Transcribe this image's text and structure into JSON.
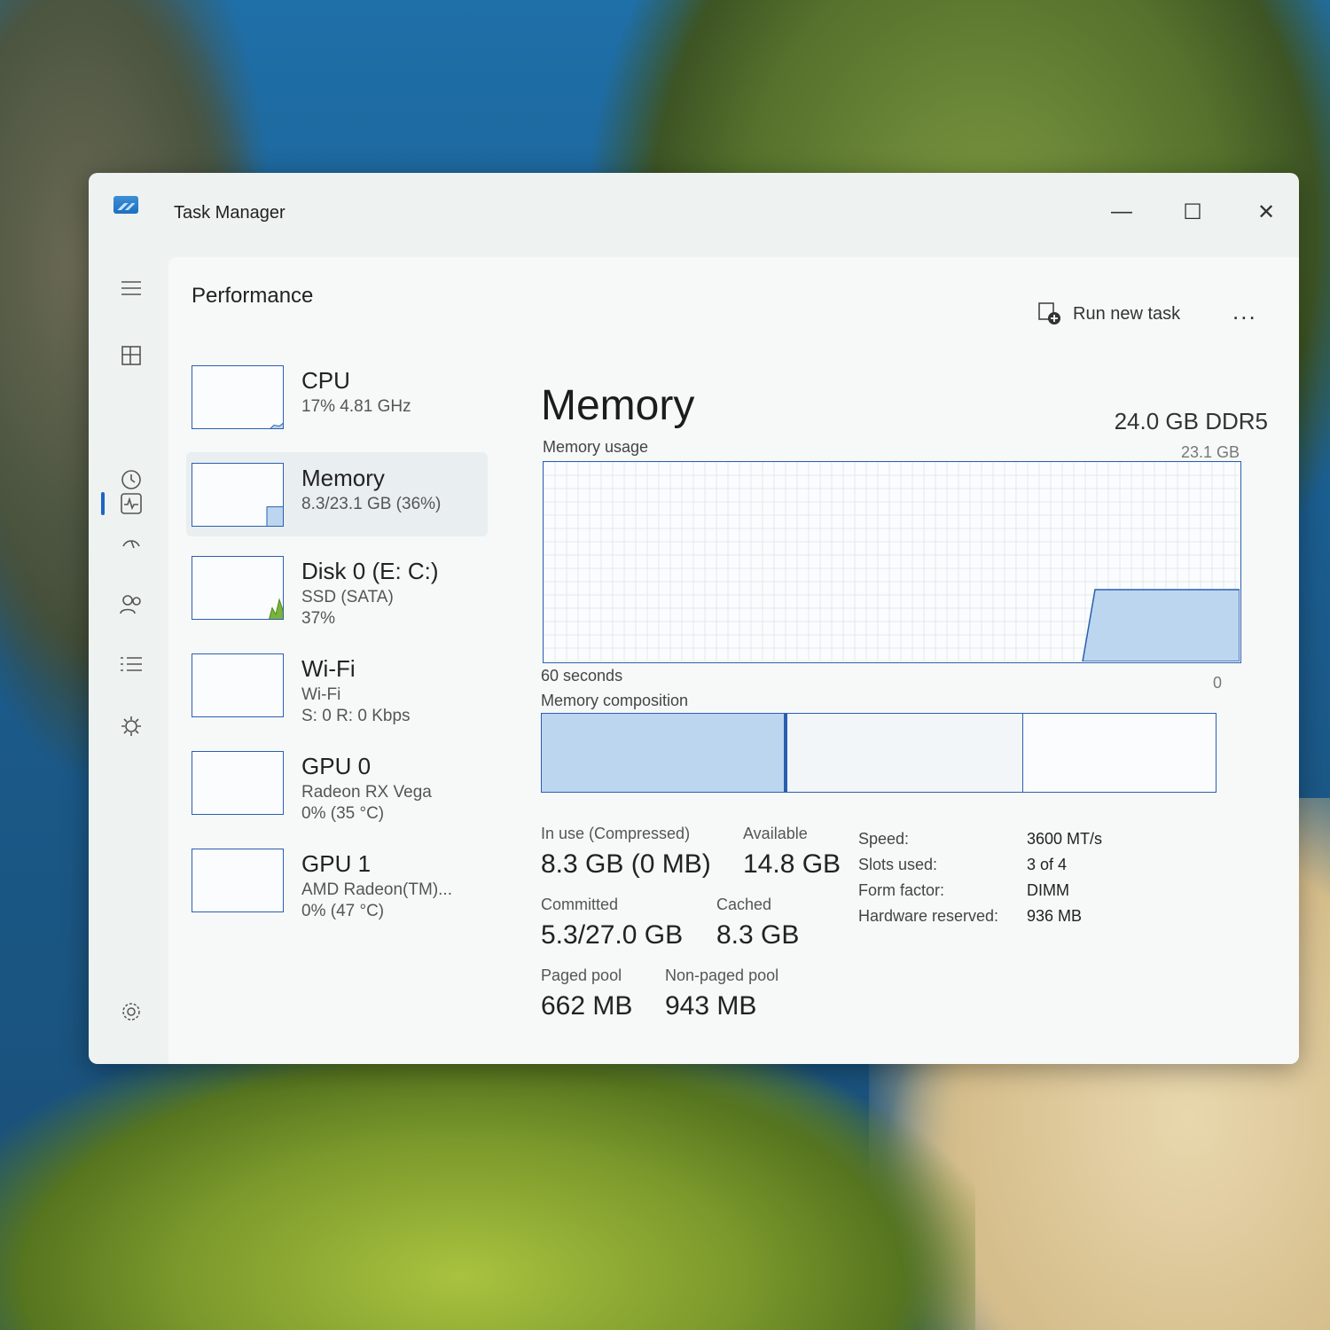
{
  "window": {
    "title": "Task Manager"
  },
  "window_controls": {
    "minimize": "—",
    "maximize": "☐",
    "close": "✕"
  },
  "header": {
    "page_title": "Performance",
    "run_new_task": "Run new task",
    "more": "..."
  },
  "nav": {
    "icons": [
      "hamburger-icon",
      "processes-icon",
      "performance-icon",
      "app-history-icon",
      "startup-apps-icon",
      "users-icon",
      "details-icon",
      "services-icon",
      "settings-icon"
    ]
  },
  "sidebar": {
    "items": [
      {
        "name": "CPU",
        "line1": "17% 4.81 GHz",
        "line2": "",
        "level": 0.17
      },
      {
        "name": "Memory",
        "line1": "8.3/23.1 GB (36%)",
        "line2": "",
        "level": 0.36
      },
      {
        "name": "Disk 0 (E: C:)",
        "line1": "SSD (SATA)",
        "line2": "37%",
        "level": 0.37
      },
      {
        "name": "Wi-Fi",
        "line1": "Wi-Fi",
        "line2": "S: 0 R: 0 Kbps",
        "level": 0
      },
      {
        "name": "GPU 0",
        "line1": "Radeon RX Vega",
        "line2": "0% (35 °C)",
        "level": 0
      },
      {
        "name": "GPU 1",
        "line1": "AMD Radeon(TM)...",
        "line2": "0% (47 °C)",
        "level": 0
      }
    ]
  },
  "memory": {
    "title": "Memory",
    "type": "24.0 GB DDR5",
    "usage_label": "Memory usage",
    "max_label": "23.1 GB",
    "time_label": "60 seconds",
    "zero_label": "0",
    "composition_label": "Memory composition",
    "composition": {
      "in_use": 0.36,
      "modified": 0.005,
      "standby": 0.35,
      "free": 0.285
    },
    "usage_series": {
      "level": 0.36
    },
    "stats": {
      "in_use_label": "In use (Compressed)",
      "in_use": "8.3 GB (0 MB)",
      "available_label": "Available",
      "available": "14.8 GB",
      "committed_label": "Committed",
      "committed": "5.3/27.0 GB",
      "cached_label": "Cached",
      "cached": "8.3 GB",
      "paged_label": "Paged pool",
      "paged": "662 MB",
      "nonpaged_label": "Non-paged pool",
      "nonpaged": "943 MB"
    },
    "specs": {
      "speed_label": "Speed:",
      "speed": "3600 MT/s",
      "slots_label": "Slots used:",
      "slots": "3 of 4",
      "form_label": "Form factor:",
      "form": "DIMM",
      "hw_label": "Hardware reserved:",
      "hw": "936 MB"
    }
  },
  "colors": {
    "accent": "#1f63c6",
    "graph_line": "#2a5fb0",
    "graph_fill": "#bcd6f0",
    "grid": "#e3e8ee"
  }
}
